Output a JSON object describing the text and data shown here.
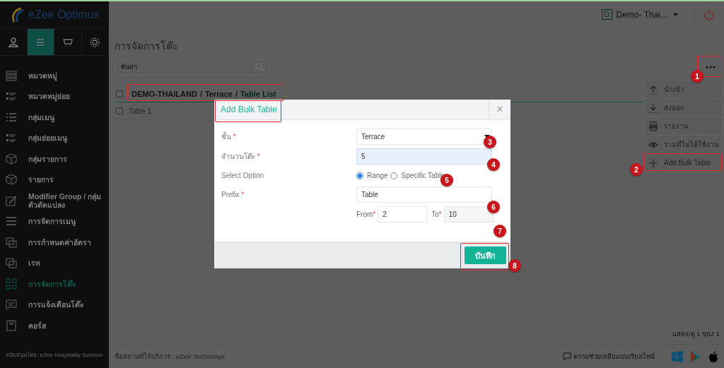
{
  "sidebar": {
    "logo": "eZee Optimus",
    "tabs": [
      {
        "selected": false
      },
      {
        "selected": true
      },
      {
        "selected": false
      },
      {
        "selected": false
      }
    ],
    "items": [
      {
        "label": "หมวดหมู่",
        "selected": false
      },
      {
        "label": "หมวดหมู่ย่อย",
        "selected": false
      },
      {
        "label": "กลุ่มเมนู",
        "selected": false
      },
      {
        "label": "กลุ่มย่อยเมนู",
        "selected": false
      },
      {
        "label": "กลุ่มรายการ",
        "selected": false
      },
      {
        "label": "รายการ",
        "selected": false
      },
      {
        "label": "Modifier Group / กลุ่มตัวดัดแปลง",
        "selected": false
      },
      {
        "label": "การจัดการเมนู",
        "selected": false
      },
      {
        "label": "การกำหนดค่าอัตรา",
        "selected": false
      },
      {
        "label": "เรท",
        "selected": false
      },
      {
        "label": "การจัดการโต๊ะ",
        "selected": true
      },
      {
        "label": "การแจ้งเตือนโต๊ะ",
        "selected": false
      },
      {
        "label": "คอร์ส",
        "selected": false
      }
    ],
    "footer": "สนับสนุนโดย: eZee Hospitality Solution"
  },
  "header": {
    "avatar_letter": "D",
    "account": "Demo- Thai…"
  },
  "page": {
    "title": "การจัดการโต๊ะ",
    "search": {
      "placeholder": "ค้นหา"
    },
    "breadcrumb": {
      "separator": "/",
      "checked": false,
      "items": [
        {
          "label": "DEMO-THAILAND",
          "selected": false
        },
        {
          "label": "Terrace",
          "selected": false
        },
        {
          "label": "Table List",
          "selected": true
        }
      ]
    },
    "rows": [
      {
        "label": "Table 1",
        "checked": false
      }
    ],
    "pagination": "แสดง/ดู 1 ของ 1"
  },
  "menu": [
    {
      "label": "นำเข้า"
    },
    {
      "label": "ส่งออก"
    },
    {
      "label": "รายงาน"
    },
    {
      "label": "รวมที่ไม่ได้ใช้งาน"
    },
    {
      "label": "Add Bulk Table"
    }
  ],
  "modal": {
    "title": "Add Bulk Table",
    "close": "×",
    "fields": [
      {
        "kind": "select",
        "label": "ชั้น",
        "mark": "*",
        "value": "Terrace",
        "focused": false
      },
      {
        "kind": "text",
        "label": "จำนวนโต๊ะ",
        "mark": "*",
        "value": "5",
        "focused": true
      },
      {
        "kind": "radio",
        "label": "Select Option",
        "options": [
          {
            "label": "Range",
            "selected": true
          },
          {
            "label": "Specific Table",
            "selected": false
          }
        ]
      },
      {
        "kind": "text",
        "label": "Prefix",
        "mark": "*",
        "value": "Table",
        "focused": false
      },
      {
        "kind": "range",
        "from_label": "From",
        "from": "2",
        "to_label": "To",
        "to": "10",
        "mark": "*"
      }
    ],
    "save": "บันทึก"
  },
  "footer": {
    "provider": "ชื่อสถานที่ให้บริการ : eZee Technosys",
    "help": "ความช่วยเหลือแบบเรียลไทม์"
  },
  "annotations": [
    {
      "number": "1"
    },
    {
      "number": "2"
    },
    {
      "number": "3"
    },
    {
      "number": "4"
    },
    {
      "number": "5"
    },
    {
      "number": "6"
    },
    {
      "number": "7"
    },
    {
      "number": "8"
    }
  ]
}
